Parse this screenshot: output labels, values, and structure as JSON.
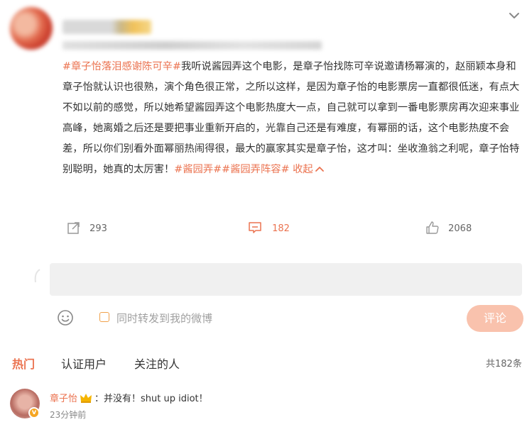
{
  "post": {
    "segments": [
      {
        "text": "#章子怡落泪感谢陈可辛#",
        "tag": true
      },
      {
        "text": "我听说酱园弄这个电影，是章子怡找陈可辛说邀请杨幂演的，赵丽颖本身和章子怡就认识也很熟，演个角色很正常，之所以这样，是因为章子怡的电影票房一直都很低迷，有点大不如以前的感觉，所以她希望酱园弄这个电影热度大一点，自己就可以拿到一番电影票房再次迎来事业高峰，她离婚之后还是要把事业重新开启的，光靠自己还是有难度，有幂丽的话，这个电影热度不会差，所以你们别看外面幂丽热闹得很，最大的赢家其实是章子怡，这才叫：坐收渔翁之利呢，章子怡特别聪明，她真的太厉害！",
        "tag": false
      },
      {
        "text": "#酱园弄##酱园弄阵容#",
        "tag": true
      },
      {
        "text": " 收起",
        "tag": true
      }
    ],
    "collapse_icon": "chevron-up-icon",
    "menu_icon": "chevron-down-icon"
  },
  "actions": {
    "repost": {
      "count": "293",
      "icon": "share-icon"
    },
    "comment": {
      "count": "182",
      "icon": "comment-icon"
    },
    "like": {
      "count": "2068",
      "icon": "thumbs-up-icon"
    }
  },
  "composer": {
    "placeholder": "",
    "emoji_icon": "smiley-icon",
    "also_repost_label": "同时转发到我的微博",
    "submit_label": "评论"
  },
  "tabs": {
    "items": [
      "热门",
      "认证用户",
      "关注的人"
    ],
    "active": "热门",
    "total": "共182条"
  },
  "comments": [
    {
      "user": "章子怡",
      "badge_icon": "crown-icon",
      "verified_icon": "verified-v-icon",
      "verified_mark": "v",
      "text": "：并没有！shut up idiot！",
      "time": "23分钟前"
    }
  ],
  "colors": {
    "accent": "#eb7350",
    "submit_disabled": "#f9c2ad",
    "checkbox": "#f0a14a",
    "input_bg": "#f0f0f0",
    "icon_gray": "#999999"
  }
}
